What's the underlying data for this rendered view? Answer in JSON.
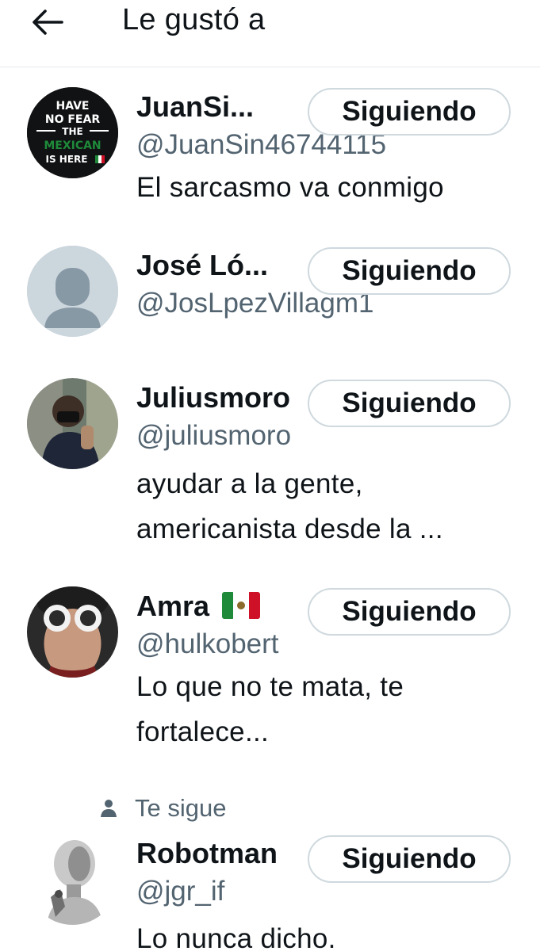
{
  "header": {
    "title": "Le gustó a",
    "back_icon": "arrow-left-icon"
  },
  "colors": {
    "text": "#0f1419",
    "secondary": "#536471",
    "border": "#cfd9de"
  },
  "users": [
    {
      "name": "JuanSi...",
      "handle": "@JuanSin46744115",
      "bio": [
        "El sarcasmo va conmigo"
      ],
      "button": "Siguiendo",
      "avatar_text": [
        "HAVE",
        "NO FEAR",
        "THE",
        "MEXICAN",
        "IS HERE"
      ]
    },
    {
      "name": "José Ló...",
      "handle": "@JosLpezVillagm1",
      "bio": [],
      "button": "Siguiendo"
    },
    {
      "name": "Juliusmoro",
      "handle": "@juliusmoro",
      "bio": [
        "ayudar a la gente,",
        "americanista desde la ..."
      ],
      "button": "Siguiendo"
    },
    {
      "name": "Amra",
      "name_flag": "mexico-flag-icon",
      "handle": "@hulkobert",
      "bio": [
        "Lo que no te mata, te",
        "fortalece..."
      ],
      "button": "Siguiendo"
    },
    {
      "follows_you": "Te sigue",
      "name": "Robotman",
      "handle": "@jgr_if",
      "bio": [
        "Lo nunca dicho."
      ],
      "button": "Siguiendo"
    }
  ]
}
